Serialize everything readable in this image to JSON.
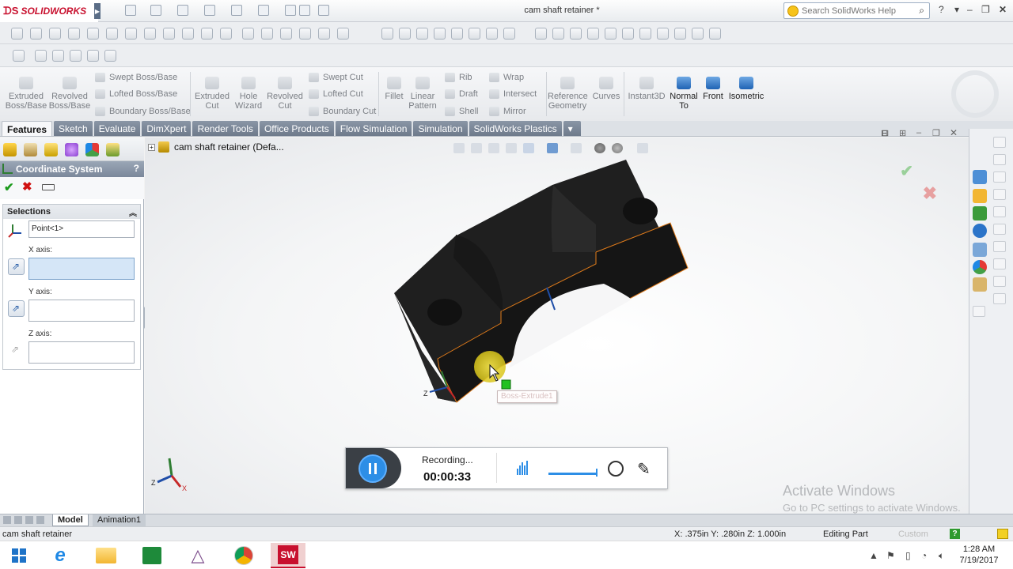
{
  "app": {
    "brand": "SOLIDWORKS",
    "title": "cam shaft retainer *"
  },
  "search": {
    "placeholder": "Search SolidWorks Help"
  },
  "command_manager": {
    "buttons": [
      {
        "id": "extruded-boss",
        "label": "Extruded\nBoss/Base"
      },
      {
        "id": "revolved-boss",
        "label": "Revolved\nBoss/Base"
      },
      {
        "id": "extruded-cut",
        "label": "Extruded\nCut"
      },
      {
        "id": "hole-wizard",
        "label": "Hole\nWizard"
      },
      {
        "id": "revolved-cut",
        "label": "Revolved\nCut"
      },
      {
        "id": "fillet",
        "label": "Fillet"
      },
      {
        "id": "linear-pattern",
        "label": "Linear\nPattern"
      },
      {
        "id": "reference-geometry",
        "label": "Reference\nGeometry"
      },
      {
        "id": "curves",
        "label": "Curves"
      },
      {
        "id": "instant3d",
        "label": "Instant3D"
      },
      {
        "id": "normal-to",
        "label": "Normal\nTo"
      },
      {
        "id": "front",
        "label": "Front"
      },
      {
        "id": "isometric",
        "label": "Isometric"
      }
    ],
    "small": {
      "swept_boss": "Swept Boss/Base",
      "lofted_boss": "Lofted Boss/Base",
      "boundary_boss": "Boundary Boss/Base",
      "swept_cut": "Swept Cut",
      "lofted_cut": "Lofted Cut",
      "boundary_cut": "Boundary Cut",
      "rib": "Rib",
      "draft": "Draft",
      "shell": "Shell",
      "wrap": "Wrap",
      "intersect": "Intersect",
      "mirror": "Mirror"
    }
  },
  "tabs": [
    "Features",
    "Sketch",
    "Evaluate",
    "DimXpert",
    "Render Tools",
    "Office Products",
    "Flow Simulation",
    "Simulation",
    "SolidWorks Plastics"
  ],
  "property_manager": {
    "title": "Coordinate System",
    "help": "?",
    "section": "Selections",
    "origin_value": "Point<1>",
    "x_label": "X axis:",
    "y_label": "Y axis:",
    "z_label": "Z axis:"
  },
  "graphics": {
    "tree_root": "cam shaft retainer  (Defa...",
    "tooltip": "Boss-Extrude1",
    "triad_z": "Z",
    "triad_x": "X",
    "activate_line1": "Activate Windows",
    "activate_line2": "Go to PC settings to activate Windows."
  },
  "recorder": {
    "status": "Recording...",
    "time": "00:00:33"
  },
  "bottom_tabs": {
    "model": "Model",
    "animation": "Animation1"
  },
  "status_bar": {
    "document": "cam shaft retainer",
    "coords": "X: .375in Y: .280in Z: 1.000in",
    "mode": "Editing Part",
    "units": "Custom"
  },
  "taskbar": {
    "time": "1:28 AM",
    "date": "7/19/2017"
  },
  "colors": {
    "accent": "#2d8ee6",
    "brand": "#c8102e",
    "part": "#1f1f1f",
    "edge_highlight": "#e07b1a"
  }
}
